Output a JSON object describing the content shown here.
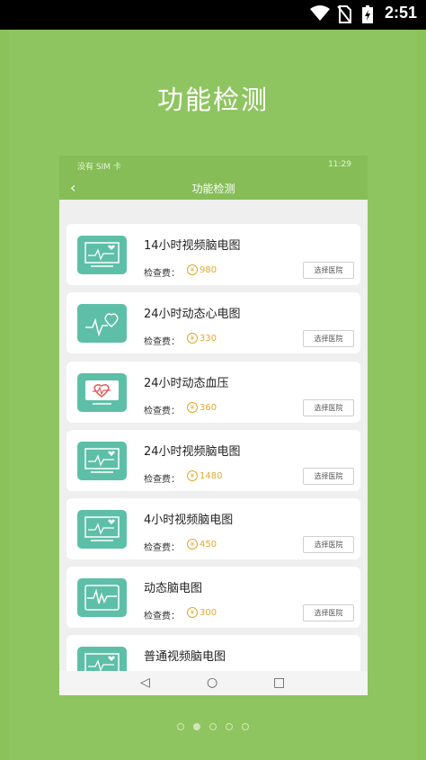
{
  "status_bar": {
    "time": "2:51",
    "icons": [
      "wifi-icon",
      "no-sim-icon",
      "battery-charging-icon"
    ]
  },
  "promo": {
    "title": "功能检测"
  },
  "inner_status_bar": {
    "left": "没有 SIM 卡",
    "right": "11:29"
  },
  "inner_nav": {
    "title": "功能检测",
    "back_icon": "chevron-left-icon"
  },
  "items": [
    {
      "name": "14小时视频脑电图",
      "fee_label": "检查费：",
      "coin": "¥",
      "price": "980",
      "button": "选择医院",
      "icon": "monitor-heart-icon"
    },
    {
      "name": "24小时动态心电图",
      "fee_label": "检查费：",
      "coin": "¥",
      "price": "330",
      "button": "选择医院",
      "icon": "heart-pulse-icon"
    },
    {
      "name": "24小时动态血压",
      "fee_label": "检查费：",
      "coin": "¥",
      "price": "360",
      "button": "选择医院",
      "icon": "blood-pressure-icon"
    },
    {
      "name": "24小时视频脑电图",
      "fee_label": "检查费：",
      "coin": "¥",
      "price": "1480",
      "button": "选择医院",
      "icon": "monitor-heart-icon"
    },
    {
      "name": "4小时视频脑电图",
      "fee_label": "检查费：",
      "coin": "¥",
      "price": "450",
      "button": "选择医院",
      "icon": "monitor-heart-icon"
    },
    {
      "name": "动态脑电图",
      "fee_label": "检查费：",
      "coin": "¥",
      "price": "300",
      "button": "选择医院",
      "icon": "eeg-wave-icon"
    },
    {
      "name": "普通视频脑电图",
      "icon": "monitor-heart-icon"
    }
  ],
  "pager": {
    "count": 5,
    "active": 1
  }
}
